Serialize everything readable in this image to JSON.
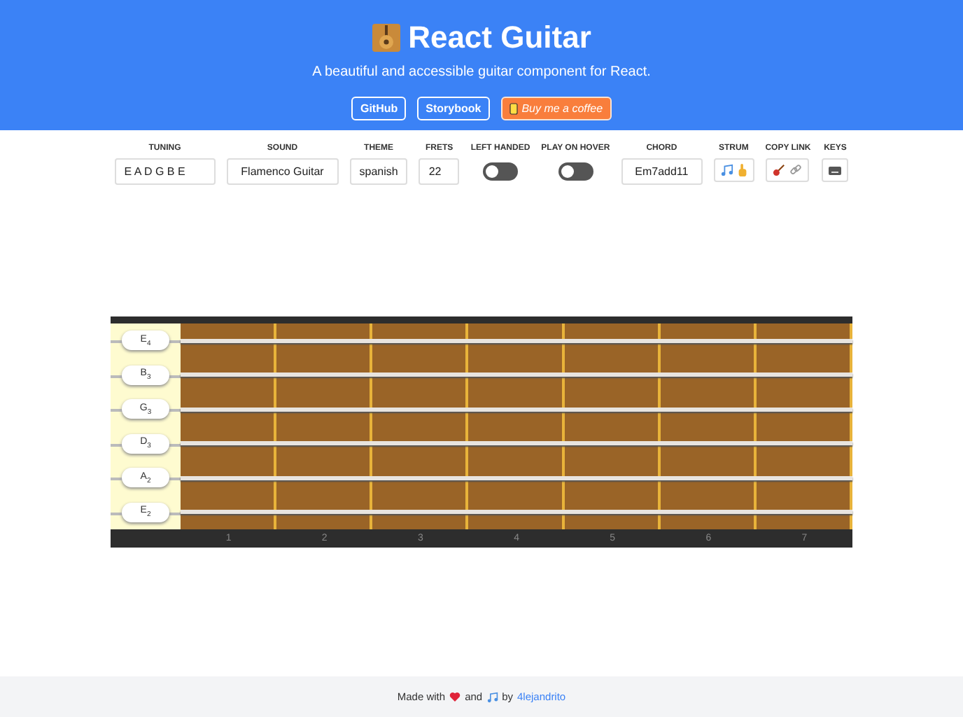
{
  "header": {
    "title": "React Guitar",
    "subtitle": "A beautiful and accessible guitar component for React.",
    "links": [
      {
        "label": "GitHub",
        "kind": "outline"
      },
      {
        "label": "Storybook",
        "kind": "outline"
      },
      {
        "label": "Buy me a coffee",
        "kind": "coffee"
      }
    ]
  },
  "controls": [
    {
      "label": "TUNING",
      "kind": "text",
      "value": "E A D G B E"
    },
    {
      "label": "SOUND",
      "kind": "select",
      "value": "Flamenco Guitar"
    },
    {
      "label": "THEME",
      "kind": "select",
      "value": "spanish"
    },
    {
      "label": "FRETS",
      "kind": "number",
      "value": "22"
    },
    {
      "label": "LEFT HANDED",
      "kind": "toggle",
      "on": false
    },
    {
      "label": "PLAY ON HOVER",
      "kind": "toggle",
      "on": false
    },
    {
      "label": "CHORD",
      "kind": "select",
      "value": "Em7add11"
    },
    {
      "label": "STRUM",
      "kind": "strum"
    },
    {
      "label": "COPY LINK",
      "kind": "copy"
    },
    {
      "label": "KEYS",
      "kind": "keys"
    }
  ],
  "guitar": {
    "strings": [
      "E$_{4}$",
      "B$_{3}$",
      "G$_{3}$",
      "D$_{3}$",
      "A$_{2}$",
      "E$_{2}$"
    ],
    "fret_numbers": [
      "1",
      "2",
      "3",
      "4",
      "5",
      "6",
      "7"
    ]
  },
  "footer": {
    "made_with": "Made with",
    "and": "and",
    "by": "by",
    "author": "4lejandrito"
  }
}
